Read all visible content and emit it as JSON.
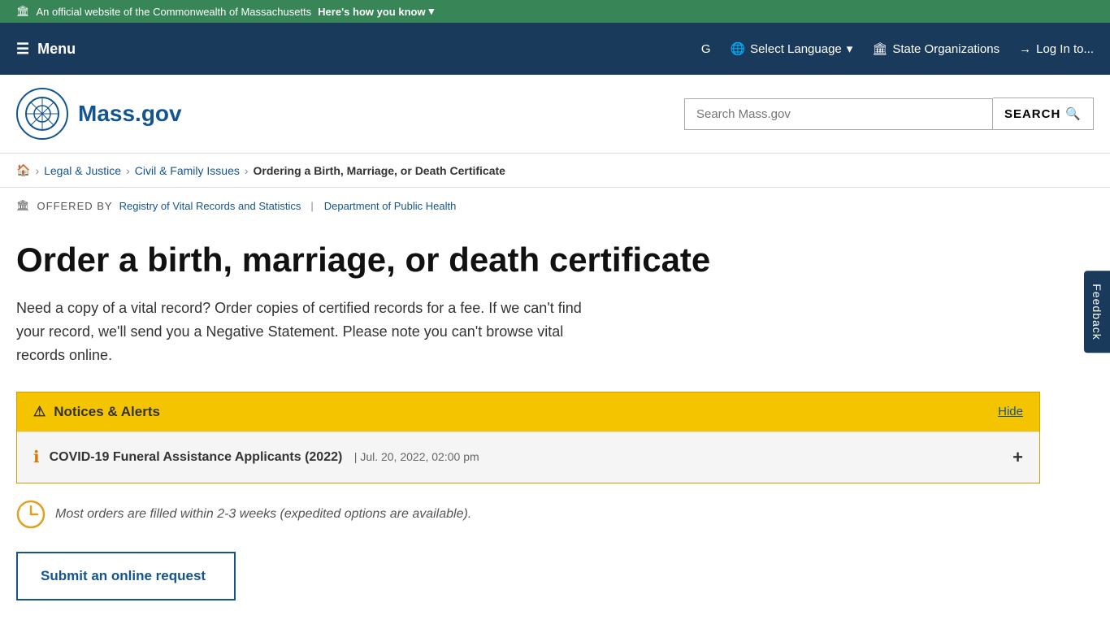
{
  "topBanner": {
    "text": "An official website of the Commonwealth of Massachusetts",
    "linkText": "Here's how you know",
    "icon": "🏛"
  },
  "nav": {
    "menuLabel": "Menu",
    "menuIcon": "☰",
    "selectLanguage": "Select Language",
    "stateOrganizations": "State Organizations",
    "logIn": "Log In to..."
  },
  "header": {
    "logoText": "Mass.gov",
    "searchPlaceholder": "Search Mass.gov",
    "searchButtonLabel": "SEARCH"
  },
  "breadcrumb": {
    "homeIcon": "🏠",
    "items": [
      {
        "label": "Legal & Justice",
        "href": "#"
      },
      {
        "label": "Civil & Family Issues",
        "href": "#"
      },
      {
        "label": "Ordering a Birth, Marriage, or Death Certificate",
        "href": "#"
      }
    ]
  },
  "offeredBy": {
    "label": "OFFERED BY",
    "org1": "Registry of Vital Records and Statistics",
    "org2": "Department of Public Health"
  },
  "page": {
    "title": "Order a birth, marriage, or death certificate",
    "description": "Need a copy of a vital record? Order copies of certified records for a fee. If we can't find your record, we'll send you a Negative Statement. Please note you can't browse vital records online."
  },
  "notices": {
    "headerLabel": "Notices & Alerts",
    "hideLabel": "Hide",
    "alertIcon": "⚠",
    "items": [
      {
        "icon": "ℹ",
        "title": "COVID-19 Funeral Assistance Applicants (2022)",
        "date": "Jul. 20, 2022, 02:00 pm"
      }
    ]
  },
  "orderInfo": {
    "text": "Most orders are filled within 2-3 weeks (expedited options are available)."
  },
  "submitButton": {
    "label": "Submit an online request"
  },
  "feedback": {
    "label": "Feedback"
  }
}
